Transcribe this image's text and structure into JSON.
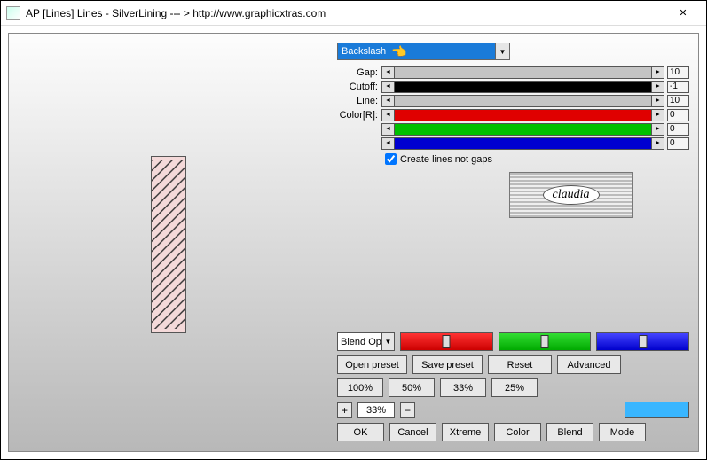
{
  "window": {
    "title": "AP [Lines]  Lines - SilverLining    --- >  http://www.graphicxtras.com"
  },
  "dropdown": {
    "value": "Backslash"
  },
  "params": [
    {
      "label": "Gap:",
      "value": "10",
      "track": "#c4c4c4"
    },
    {
      "label": "Cutoff:",
      "value": "-1",
      "track": "#000000"
    },
    {
      "label": "Line:",
      "value": "10",
      "track": "#c4c4c4"
    },
    {
      "label": "Color[R]:",
      "value": "0",
      "track": "#e00000"
    },
    {
      "label": "",
      "value": "0",
      "track": "#00c000"
    },
    {
      "label": "",
      "value": "0",
      "track": "#0000d0"
    }
  ],
  "checkbox": {
    "label": "Create lines not gaps",
    "checked": true
  },
  "logo_text": "claudia",
  "blend_select": "Blend Options",
  "preset_row": {
    "open": "Open preset",
    "save": "Save preset",
    "reset": "Reset",
    "advanced": "Advanced"
  },
  "zoom_presets": [
    "100%",
    "50%",
    "33%",
    "25%"
  ],
  "zoom": {
    "plus": "+",
    "value": "33%",
    "minus": "−"
  },
  "swatch_color": "#39b6ff",
  "final_row": [
    "OK",
    "Cancel",
    "Xtreme",
    "Color",
    "Blend",
    "Mode"
  ]
}
